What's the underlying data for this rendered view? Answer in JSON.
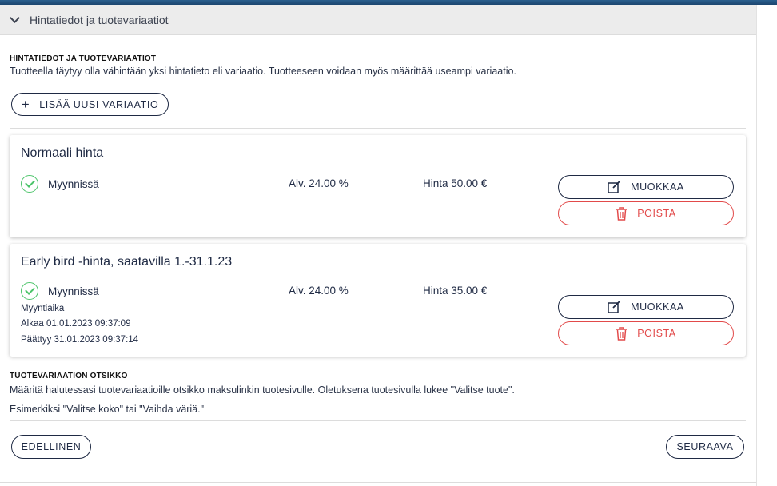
{
  "accordion": {
    "title": "Hintatiedot ja tuotevariaatiot"
  },
  "pricing_section": {
    "heading": "HINTATIEDOT JA TUOTEVARIAATIOT",
    "description": "Tuotteella täytyy olla vähintään yksi hintatieto eli variaatio. Tuotteeseen voidaan myös määrittää useampi variaatio.",
    "add_button": "LISÄÄ UUSI VARIAATIO"
  },
  "variations": [
    {
      "title": "Normaali hinta",
      "status": "Myynnissä",
      "vat": "Alv. 24.00 %",
      "price": "Hinta 50.00 €",
      "edit_label": "MUOKKAA",
      "delete_label": "POISTA"
    },
    {
      "title": "Early bird -hinta, saatavilla 1.-31.1.23",
      "status": "Myynnissä",
      "vat": "Alv. 24.00 %",
      "price": "Hinta 35.00 €",
      "sale_period_label": "Myyntiaika",
      "starts": "Alkaa 01.01.2023 09:37:09",
      "ends": "Päättyy 31.01.2023 09:37:14",
      "edit_label": "MUOKKAA",
      "delete_label": "POISTA"
    }
  ],
  "variation_title_section": {
    "heading": "TUOTEVARIAATION OTSIKKO",
    "description": "Määritä halutessasi tuotevariaatioille otsikko maksulinkin tuotesivulle. Oletuksena tuotesivulla lukee \"Valitse tuote\".",
    "example": "Esimerkiksi \"Valitse koko\" tai \"Vaihda väriä.\""
  },
  "navigation": {
    "previous": "EDELLINEN",
    "next": "SEURAAVA"
  },
  "colors": {
    "primary": "#1f2a44",
    "success": "#4cc46a",
    "danger": "#e24a4a",
    "header_bar": "#1c4670"
  },
  "icons": {
    "accordion": "chevron-down-icon",
    "add": "plus-icon",
    "status": "check-circle-icon",
    "edit": "edit-icon",
    "delete": "trash-icon"
  }
}
